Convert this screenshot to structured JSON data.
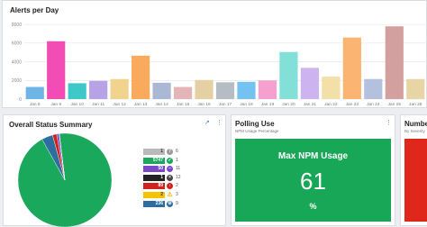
{
  "alerts_panel": {
    "title": "Alerts per Day"
  },
  "chart_data": {
    "type": "bar",
    "title": "Alerts per Day",
    "categories": [
      "Jan 8",
      "Jan 9",
      "Jan 10",
      "Jan 11",
      "Jan 12",
      "Jan 13",
      "Jan 14",
      "Jan 15",
      "Jan 16",
      "Jan 17",
      "Jan 18",
      "Jan 19",
      "Jan 20",
      "Jan 21",
      "Jan 22",
      "Jan 23",
      "Jan 24",
      "Jan 25",
      "Jan 26"
    ],
    "values": [
      1300,
      6200,
      1700,
      1950,
      2150,
      4650,
      1750,
      1300,
      2050,
      1800,
      1850,
      2000,
      5050,
      3350,
      2400,
      6600,
      2150,
      7800,
      2150
    ],
    "colors": [
      "#6fb4e6",
      "#f14db5",
      "#3fc8c8",
      "#b7a2e6",
      "#f2d38e",
      "#f9aa5d",
      "#aab8d4",
      "#e4b5b7",
      "#e4d0a2",
      "#b6bcc3",
      "#74c2ef",
      "#f6a0d0",
      "#83e0d8",
      "#cdb3ef",
      "#f3e0a8",
      "#fcb472",
      "#b3c0de",
      "#d49f9f",
      "#e8d5a5"
    ],
    "yticks": [
      0,
      2000,
      4000,
      6000,
      8000
    ],
    "ytick_labels": [
      "0",
      "2000",
      "4000",
      "6000",
      "8000"
    ],
    "ylim": [
      0,
      8400
    ],
    "grid": true
  },
  "summary_panel": {
    "title": "Overall Status Summary",
    "icons": [
      "external-link-icon",
      "more-icon"
    ],
    "legend": [
      {
        "count": "1",
        "count_bg": "#b9b9b9",
        "count_color": "#333333",
        "icon": "question",
        "icon_color": "#9a9a9a",
        "num": "6"
      },
      {
        "count": "5747",
        "count_bg": "#1aa85c",
        "count_color": "#ffffff",
        "icon": "check",
        "icon_color": "#1aa85c",
        "num": "1"
      },
      {
        "count": "50",
        "count_bg": "#7a48c8",
        "count_color": "#ffffff",
        "icon": "minus",
        "icon_color": "#7a48c8",
        "num": "11"
      },
      {
        "count": "1",
        "count_bg": "#222222",
        "count_color": "#ffffff",
        "icon": "x",
        "icon_color": "#444444",
        "num": "12"
      },
      {
        "count": "89",
        "count_bg": "#d0231d",
        "count_color": "#ffffff",
        "icon": "down",
        "icon_color": "#d0231d",
        "num": "2"
      },
      {
        "count": "2",
        "count_bg": "#f7c200",
        "count_color": "#333333",
        "icon": "warning",
        "icon_color": "#f0b400",
        "num": "3"
      },
      {
        "count": "236",
        "count_bg": "#2d6e9e",
        "count_color": "#ffffff",
        "icon": "gear",
        "icon_color": "#2d6e9e",
        "num": "9"
      }
    ],
    "pie": [
      {
        "label": "Up",
        "value": 5747,
        "color": "#1aa85c"
      },
      {
        "label": "Unknown",
        "value": 236,
        "color": "#2d6e9e"
      },
      {
        "label": "Down",
        "value": 89,
        "color": "#d0231d"
      },
      {
        "label": "Unmanaged",
        "value": 50,
        "color": "#7a48c8"
      },
      {
        "label": "Warning",
        "value": 2,
        "color": "#f7c200"
      },
      {
        "label": "Shutdown",
        "value": 1,
        "color": "#222222"
      },
      {
        "label": "Other",
        "value": 1,
        "color": "#b9b9b9"
      }
    ]
  },
  "polling_panel": {
    "title": "Polling Use",
    "subtitle": "NPM Usage Percentage",
    "icon": "more-icon",
    "tile_title": "Max NPM Usage",
    "tile_value": "61",
    "tile_unit": "%",
    "tile_color": "#18a657"
  },
  "numbe_panel": {
    "title": "Numbe",
    "subtitle": "By Severity",
    "tile_color": "#e0271c"
  }
}
